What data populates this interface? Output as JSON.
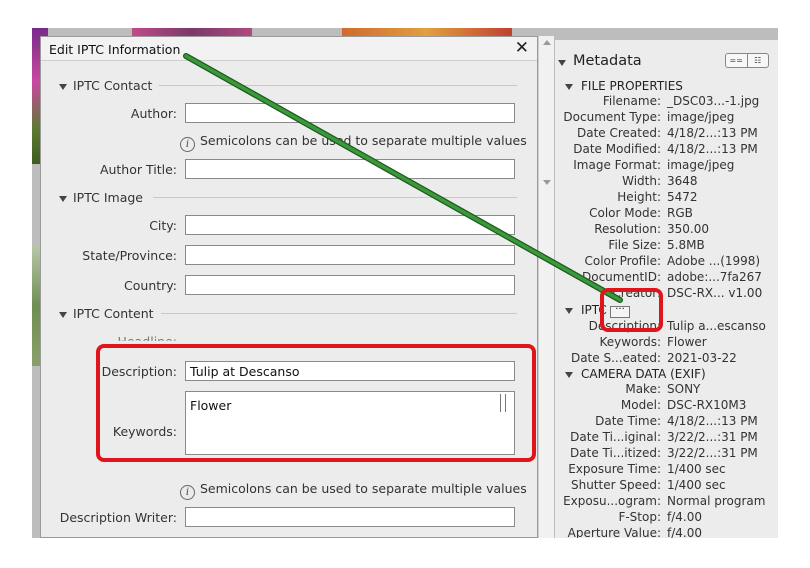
{
  "dialog": {
    "title": "Edit IPTC Information",
    "close_glyph": "✕",
    "sections": {
      "contact": "IPTC Contact",
      "image": "IPTC Image",
      "content": "IPTC Content"
    },
    "labels": {
      "author": "Author:",
      "author_title": "Author Title:",
      "city": "City:",
      "state": "State/Province:",
      "country": "Country:",
      "headline": "Headline:",
      "description": "Description:",
      "keywords": "Keywords:",
      "description_writer": "Description Writer:"
    },
    "values": {
      "author": "",
      "author_title": "",
      "city": "",
      "state": "",
      "country": "",
      "description": "Tulip at Descanso",
      "keywords": "Flower",
      "description_writer": ""
    },
    "hint": "Semicolons can be used to separate multiple values",
    "info_glyph": "i"
  },
  "metadata": {
    "title": "Metadata",
    "view_toggle": [
      "==",
      "☷"
    ],
    "file_properties": {
      "header": "FILE PROPERTIES",
      "rows": [
        {
          "k": "Filename:",
          "v": "_DSC03...-1.jpg"
        },
        {
          "k": "Document Type:",
          "v": "image/jpeg"
        },
        {
          "k": "Date Created:",
          "v": "4/18/2...:13 PM"
        },
        {
          "k": "Date Modified:",
          "v": "4/18/2...:13 PM"
        },
        {
          "k": "Image Format:",
          "v": "image/jpeg"
        },
        {
          "k": "Width:",
          "v": "3648"
        },
        {
          "k": "Height:",
          "v": "5472"
        },
        {
          "k": "Color Mode:",
          "v": "RGB"
        },
        {
          "k": "Resolution:",
          "v": "350.00"
        },
        {
          "k": "File Size:",
          "v": "5.8MB"
        },
        {
          "k": "Color Profile:",
          "v": "Adobe ...(1998)"
        },
        {
          "k": "DocumentID:",
          "v": "adobe:...7fa267"
        },
        {
          "k": "Creator:",
          "v": "DSC-RX... v1.00"
        }
      ]
    },
    "iptc": {
      "header": "IPTC",
      "more_glyph": "···",
      "rows": [
        {
          "k": "Description:",
          "v": "Tulip a...escanso"
        },
        {
          "k": "Keywords:",
          "v": "Flower"
        },
        {
          "k": "Date S...eated:",
          "v": "2021-03-22"
        }
      ]
    },
    "exif": {
      "header": "CAMERA DATA (EXIF)",
      "rows": [
        {
          "k": "Make:",
          "v": "SONY"
        },
        {
          "k": "Model:",
          "v": "DSC-RX10M3"
        },
        {
          "k": "Date Time:",
          "v": "4/18/2...:13 PM"
        },
        {
          "k": "Date Ti...iginal:",
          "v": "3/22/2...:31 PM"
        },
        {
          "k": "Date Ti...itized:",
          "v": "3/22/2...:31 PM"
        },
        {
          "k": "Exposure Time:",
          "v": "1/400 sec"
        },
        {
          "k": "Shutter Speed:",
          "v": "1/400 sec"
        },
        {
          "k": "Exposu...ogram:",
          "v": "Normal program"
        },
        {
          "k": "F-Stop:",
          "v": "f/4.00"
        },
        {
          "k": "Aperture Value:",
          "v": "f/4.00"
        }
      ]
    }
  },
  "colors": {
    "annotation_red": "#e0151b",
    "arrow_green": "#3a9a3a"
  }
}
